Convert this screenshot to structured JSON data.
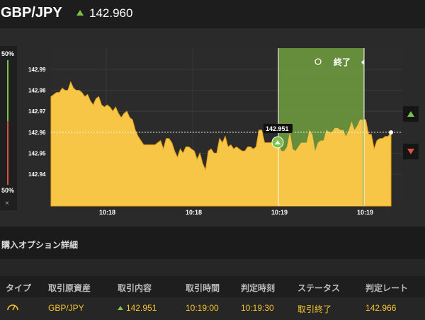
{
  "header": {
    "pair": "GBP/JPY",
    "rate": "142.960"
  },
  "sidebar": {
    "top_pct": "50%",
    "bottom_pct": "50%",
    "close": "×"
  },
  "chart": {
    "end_label": "終了",
    "marker_label": "142.951",
    "y_ticks": [
      "142.99",
      "142.98",
      "142.97",
      "142.96",
      "142.95",
      "142.94"
    ],
    "x_ticks": [
      "10:18",
      "10:18",
      "10:19",
      "10:19"
    ],
    "colors": {
      "area": "#f7c646",
      "window": "#6e9b3f",
      "up": "#7cc14a",
      "down": "#e2523b"
    }
  },
  "section": {
    "title": "購入オプション詳細"
  },
  "table": {
    "headers": [
      "タイプ",
      "取引原資産",
      "取引内容",
      "取引時間",
      "判定時刻",
      "ステータス",
      "判定レート"
    ],
    "row": {
      "asset": "GBP/JPY",
      "content": "142.951",
      "trade_time": "10:19:00",
      "judge_time": "10:19:30",
      "status": "取引終了",
      "judge_rate": "142.966"
    }
  },
  "chart_data": {
    "type": "area",
    "y_range": [
      142.935,
      143.0
    ],
    "entry_rate": 142.951,
    "current_rate": 142.96,
    "y": [
      142.977,
      142.978,
      142.979,
      142.979,
      142.981,
      142.98,
      142.98,
      142.984,
      142.981,
      142.98,
      142.98,
      142.979,
      142.977,
      142.978,
      142.975,
      142.973,
      142.976,
      142.977,
      142.973,
      142.972,
      142.973,
      142.972,
      142.97,
      142.972,
      142.969,
      142.967,
      142.969,
      142.97,
      142.967,
      142.966,
      142.961,
      142.958,
      142.956,
      142.954,
      142.954,
      142.954,
      142.954,
      142.954,
      142.955,
      142.956,
      142.952,
      142.957,
      142.957,
      142.955,
      142.951,
      142.948,
      142.952,
      142.95,
      142.953,
      142.953,
      142.952,
      142.951,
      142.947,
      142.95,
      142.945,
      142.942,
      142.951,
      142.952,
      142.95,
      142.95,
      142.957,
      142.955,
      142.958,
      142.953,
      142.954,
      142.952,
      142.953,
      142.952,
      142.951,
      142.951,
      142.953,
      142.953,
      142.952,
      142.953,
      142.961,
      142.961,
      142.955,
      142.955,
      142.955,
      142.955,
      142.954,
      142.954,
      142.951,
      142.951,
      142.953,
      142.96,
      142.952,
      142.951,
      142.953,
      142.955,
      142.955,
      142.955,
      142.961,
      142.959,
      142.951,
      142.955,
      142.956,
      142.956,
      142.961,
      142.96,
      142.96,
      142.962,
      142.962,
      142.961,
      142.961,
      142.958,
      142.961,
      142.965,
      142.961,
      142.963,
      142.966,
      142.966,
      142.966,
      142.959,
      142.959,
      142.952,
      142.956,
      142.957,
      142.957,
      142.958,
      142.958,
      142.96
    ]
  }
}
